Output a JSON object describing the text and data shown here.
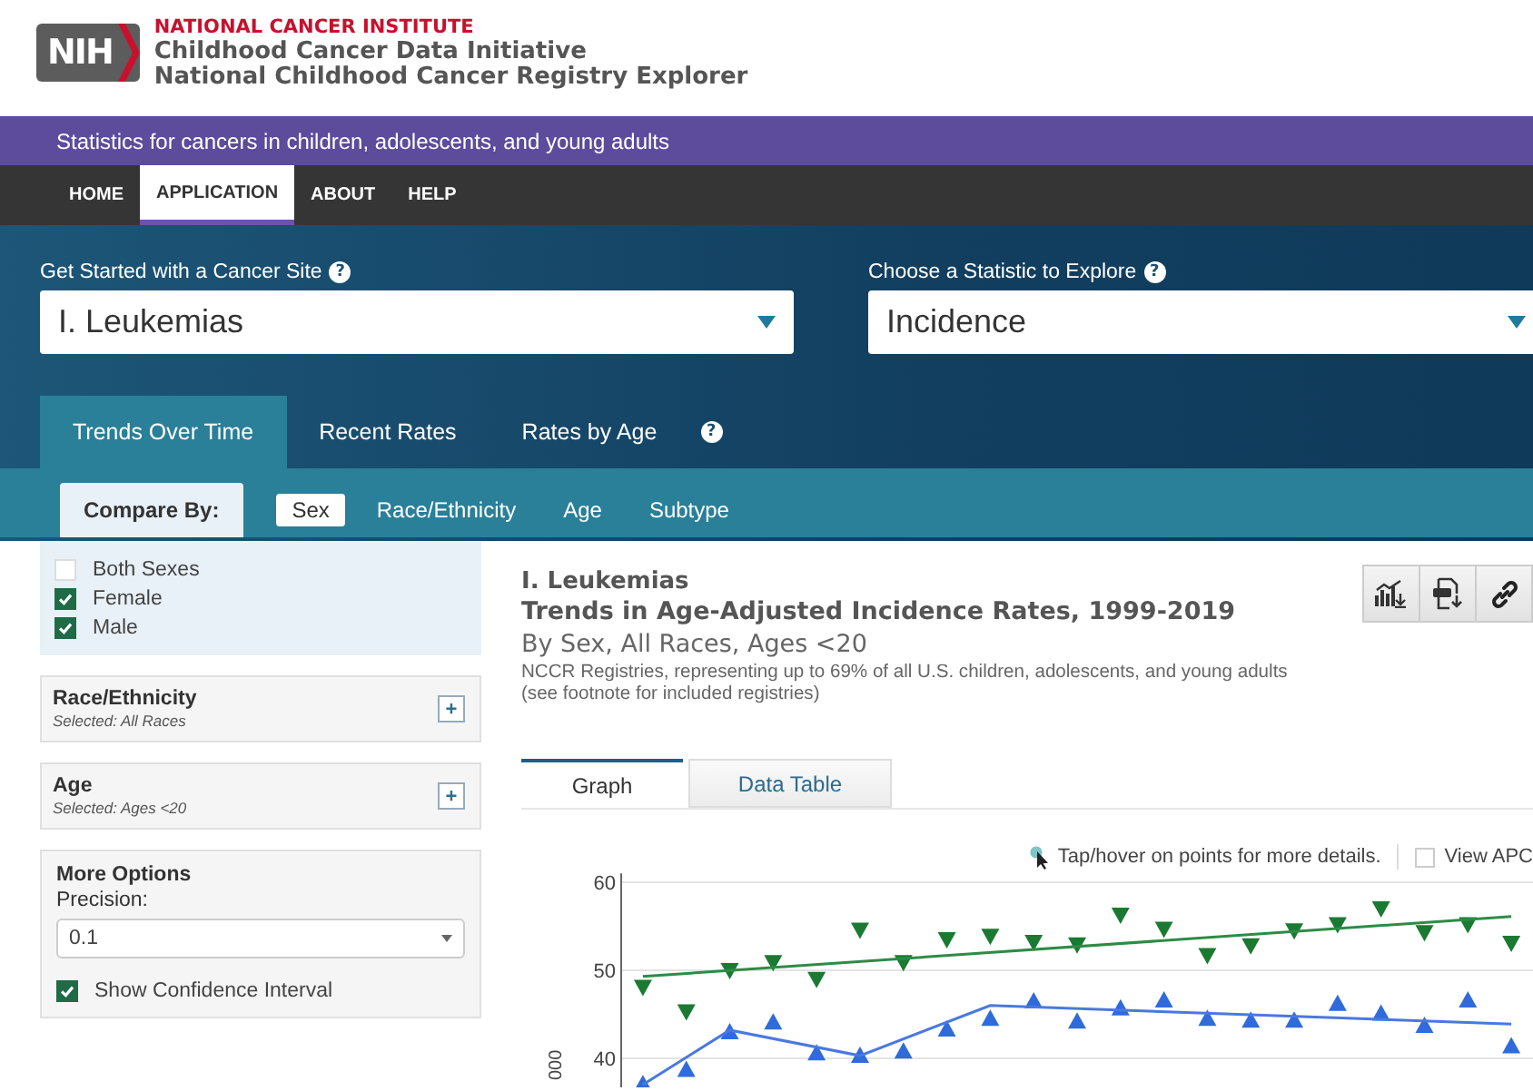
{
  "header": {
    "logo": "NIH",
    "agency": "NATIONAL CANCER INSTITUTE",
    "title_1": "Childhood Cancer Data Initiative",
    "title_2": "National Childhood Cancer Registry Explorer"
  },
  "banner": "Statistics for cancers in children, adolescents, and young adults",
  "nav": [
    {
      "label": "HOME",
      "selected": false
    },
    {
      "label": "APPLICATION",
      "selected": true
    },
    {
      "label": "ABOUT",
      "selected": false
    },
    {
      "label": "HELP",
      "selected": false
    }
  ],
  "selectors": [
    {
      "label": "Get Started with a Cancer Site",
      "help": "?",
      "value": "I. Leukemias"
    },
    {
      "label": "Choose a Statistic to Explore",
      "help": "?",
      "value": "Incidence"
    }
  ],
  "view_tabs": [
    {
      "label": "Trends Over Time",
      "selected": true
    },
    {
      "label": "Recent Rates",
      "selected": false
    },
    {
      "label": "Rates by Age",
      "selected": false
    }
  ],
  "view_help": "?",
  "compare_label": "Compare By:",
  "compare_tabs": [
    {
      "label": "Sex",
      "selected": true
    },
    {
      "label": "Race/Ethnicity",
      "selected": false
    },
    {
      "label": "Age",
      "selected": false
    },
    {
      "label": "Subtype",
      "selected": false
    }
  ],
  "sex_options": [
    {
      "label": "Both Sexes",
      "checked": false
    },
    {
      "label": "Female",
      "checked": true
    },
    {
      "label": "Male",
      "checked": true
    }
  ],
  "filters": [
    {
      "title": "Race/Ethnicity",
      "subtitle": "Selected: All Races",
      "expand": "+"
    },
    {
      "title": "Age",
      "subtitle": "Selected: Ages <20",
      "expand": "+"
    }
  ],
  "more_options": {
    "title": "More Options",
    "precision_label": "Precision:",
    "precision": "0.1",
    "confidence": {
      "label": "Show Confidence Interval",
      "checked": true
    }
  },
  "result": {
    "site": "I. Leukemias",
    "title": "Trends in Age-Adjusted Incidence Rates, 1999-2019",
    "subtitle": "By Sex, All Races, Ages <20",
    "note": "NCCR Registries, representing up to 69% of all U.S. children, adolescents, and young adults (see footnote for included registries)",
    "tabs": [
      {
        "label": "Graph",
        "selected": true
      },
      {
        "label": "Data Table",
        "selected": false
      }
    ],
    "hint": "Tap/hover on points for more details.",
    "view_apc": {
      "label": "View APC",
      "checked": false
    },
    "chart_data": {
      "type": "scatter",
      "ylabel": "000",
      "categories": [
        null,
        null,
        null,
        null,
        null,
        null,
        null,
        null,
        null,
        null,
        null,
        null,
        null,
        null,
        null,
        null,
        null,
        null,
        null,
        null,
        null
      ],
      "ylim": [
        36.6,
        61
      ],
      "yticks": [
        40,
        50,
        60
      ],
      "grid": true,
      "series": [
        {
          "type": "scatter",
          "color": "#1b7a32",
          "values": [
            48.1,
            45.3,
            50,
            50.9,
            49,
            54.6,
            50.9,
            53.5,
            53.9,
            53.2,
            52.9,
            56.3,
            54.7,
            51.7,
            52.8,
            54.5,
            55.2,
            57,
            54.3,
            55.2,
            53.1
          ]
        },
        {
          "type": "scatter",
          "color": "#2f6bdc",
          "values": [
            37.1,
            38.7,
            43,
            44.1,
            40.6,
            40.3,
            40.8,
            43.3,
            44.5,
            46.5,
            44.2,
            45.7,
            46.6,
            44.5,
            44.3,
            44.3,
            46.2,
            45.1,
            43.7,
            46.6,
            41.4
          ]
        },
        {
          "type": "line",
          "color": "#2e8b46",
          "values": [
            49.3,
            null,
            null,
            null,
            null,
            null,
            null,
            null,
            null,
            null,
            null,
            null,
            null,
            null,
            null,
            null,
            null,
            null,
            null,
            null,
            56.1
          ]
        },
        {
          "type": "line",
          "color": "#4a78e0",
          "values": [
            37,
            null,
            43.2,
            null,
            null,
            40.3,
            null,
            null,
            46,
            null,
            null,
            null,
            null,
            null,
            null,
            null,
            null,
            null,
            null,
            null,
            43.9
          ]
        }
      ]
    }
  }
}
